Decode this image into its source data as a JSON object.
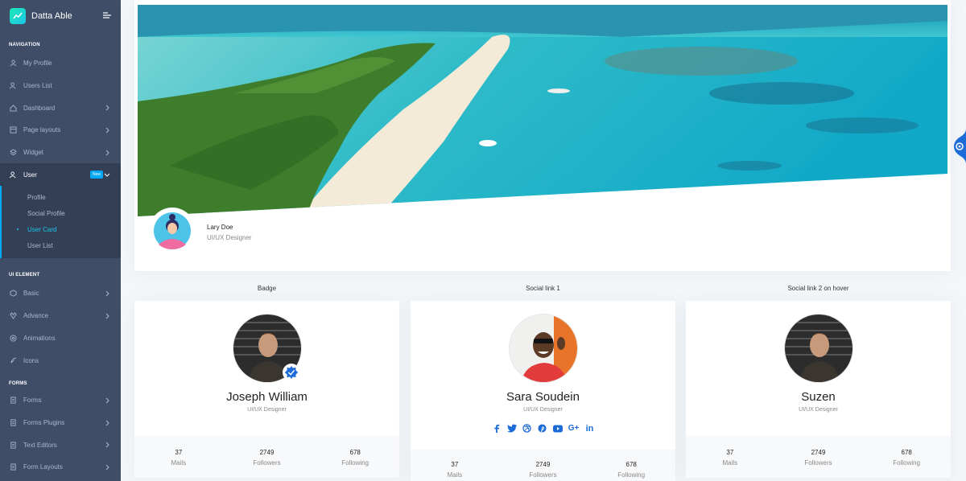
{
  "brand": {
    "name": "Datta Able"
  },
  "sidebar": {
    "caption_navigation": "NAVIGATION",
    "nav_items": [
      {
        "label": "My Profile",
        "icon": "user-icon"
      },
      {
        "label": "Users List",
        "icon": "users-icon"
      },
      {
        "label": "Dashboard",
        "icon": "home-icon"
      },
      {
        "label": "Page layouts",
        "icon": "layout-icon"
      },
      {
        "label": "Widget",
        "icon": "layers-icon"
      },
      {
        "label": "User",
        "icon": "users-icon",
        "badge": "New"
      }
    ],
    "user_submenu": [
      "Profile",
      "Social Profile",
      "User Card",
      "User List"
    ],
    "caption_ui": "UI ELEMENT",
    "ui_items": [
      {
        "label": "Basic",
        "icon": "box-icon"
      },
      {
        "label": "Advance",
        "icon": "gitlab-icon"
      },
      {
        "label": "Animations",
        "icon": "aperture-icon"
      },
      {
        "label": "Icons",
        "icon": "feather-icon"
      }
    ],
    "caption_forms": "FORMS",
    "form_items": [
      {
        "label": "Forms",
        "icon": "file-text-icon"
      },
      {
        "label": "Forms Plugins",
        "icon": "file-text-icon"
      },
      {
        "label": "Text Editors",
        "icon": "file-text-icon"
      },
      {
        "label": "Form Layouts",
        "icon": "file-text-icon"
      }
    ]
  },
  "profile": {
    "name": "Lary Doe",
    "role": "UI/UX Designer"
  },
  "cards": [
    {
      "title": "Badge",
      "name": "Joseph William",
      "role": "UI/UX Designer",
      "stats": [
        {
          "num": "37",
          "label": "Mails"
        },
        {
          "num": "2749",
          "label": "Followers"
        },
        {
          "num": "678",
          "label": "Following"
        }
      ]
    },
    {
      "title": "Social link 1",
      "name": "Sara Soudein",
      "role": "UI/UX Designer",
      "stats": [
        {
          "num": "37",
          "label": "Mails"
        },
        {
          "num": "2749",
          "label": "Followers"
        },
        {
          "num": "678",
          "label": "Following"
        }
      ]
    },
    {
      "title": "Social link 2 on hover",
      "name": "Suzen",
      "role": "UI/UX Designer",
      "stats": [
        {
          "num": "37",
          "label": "Mails"
        },
        {
          "num": "2749",
          "label": "Followers"
        },
        {
          "num": "678",
          "label": "Following"
        }
      ]
    }
  ],
  "social_icons": [
    "f",
    "twitter",
    "dribbble",
    "pinterest",
    "youtube",
    "G+",
    "in"
  ],
  "colors": {
    "sidebar": "#3f4d67",
    "accent": "#04a9f5",
    "active_link": "#1dc4e9",
    "social": "#1d6bd8"
  }
}
